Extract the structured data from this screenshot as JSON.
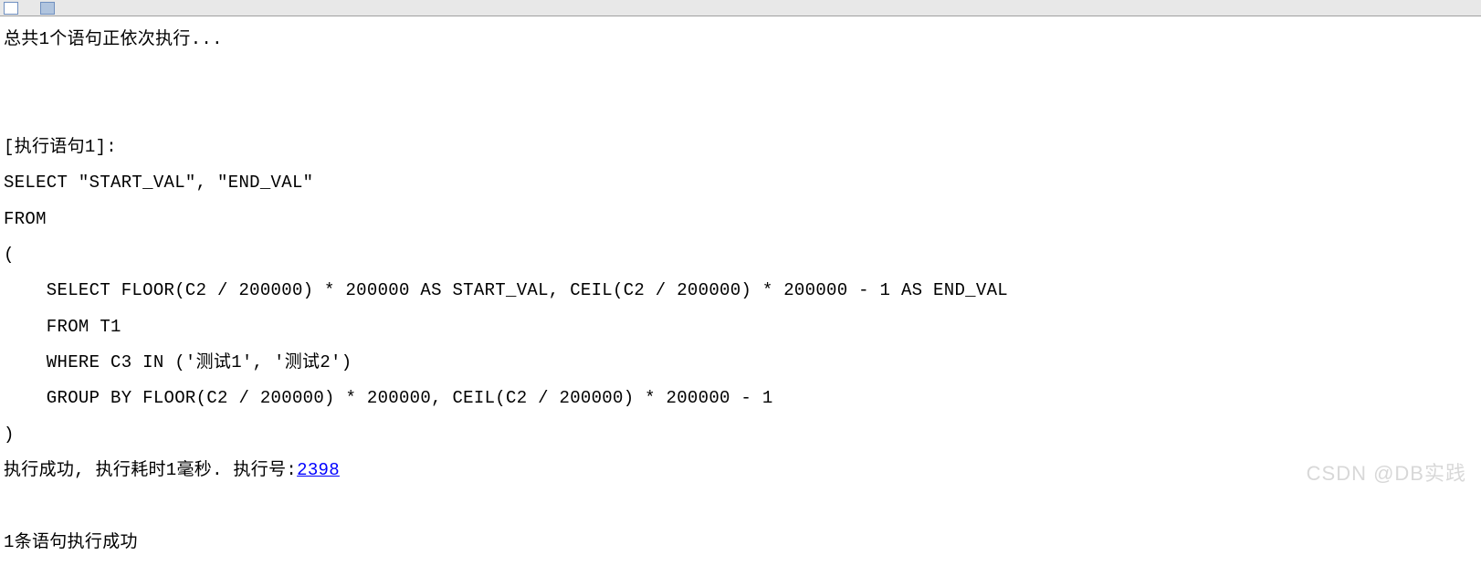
{
  "header": {
    "line": "总共1个语句正依次执行..."
  },
  "execution": {
    "stmt_header": "[执行语句1]:",
    "sql_line1": "SELECT \"START_VAL\", \"END_VAL\"",
    "sql_line2": "FROM",
    "sql_line3": "(",
    "sql_line4": "    SELECT FLOOR(C2 / 200000) * 200000 AS START_VAL, CEIL(C2 / 200000) * 200000 - 1 AS END_VAL",
    "sql_line5": "    FROM T1",
    "sql_line6": "    WHERE C3 IN ('测试1', '测试2')",
    "sql_line7": "    GROUP BY FLOOR(C2 / 200000) * 200000, CEIL(C2 / 200000) * 200000 - 1",
    "sql_line8": ")",
    "result_prefix": "执行成功, 执行耗时1毫秒. 执行号:",
    "exec_id": "2398"
  },
  "footer": {
    "summary": "1条语句执行成功"
  },
  "watermark": "CSDN @DB实践"
}
